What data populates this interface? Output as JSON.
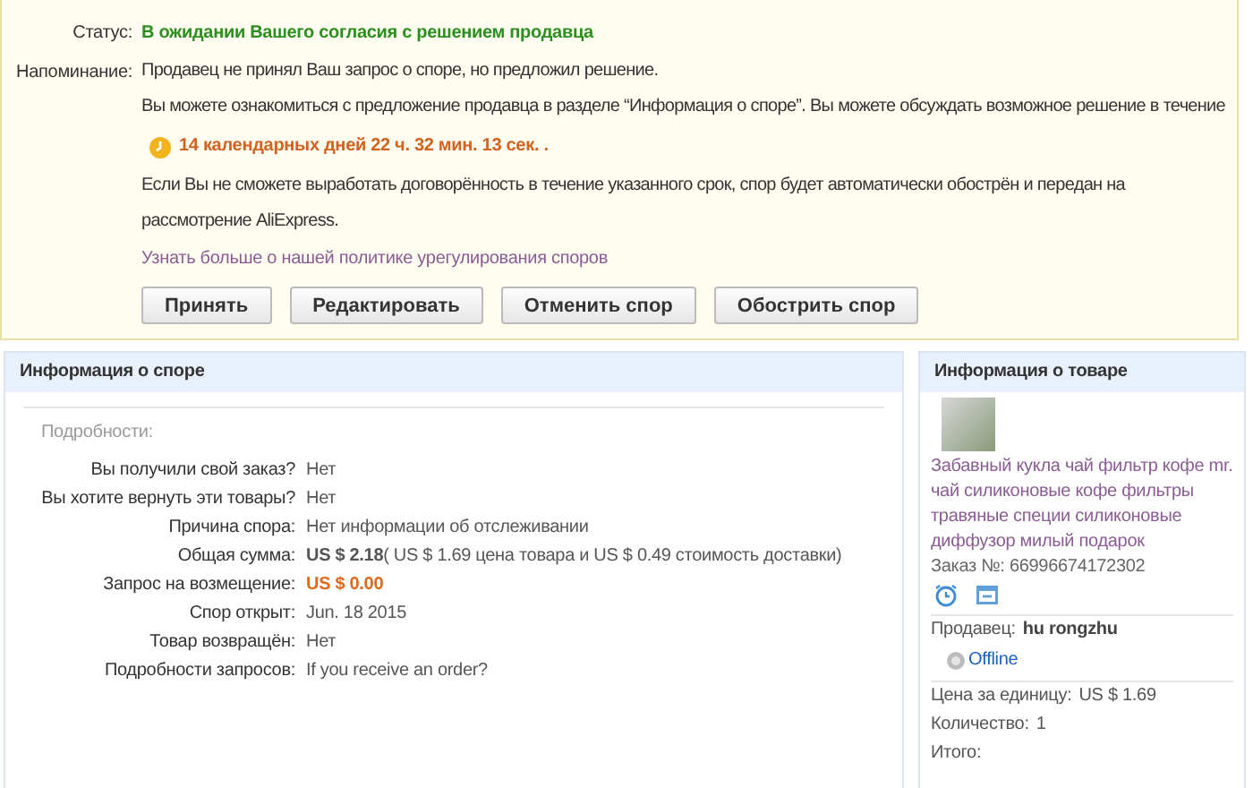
{
  "status": {
    "label": "Статус:",
    "value": "В ожидании Вашего согласия с решением продавца"
  },
  "reminder": {
    "label": "Напоминание:",
    "line_1": "Продавец не принял Ваш запрос о споре, но предложил решение.",
    "line_2": "Вы можете ознакомиться с предложение продавца в разделе “Информация о споре”. Вы можете обсуждать возможное решение в течение",
    "countdown": "14 календарных дней 22 ч. 32 мин. 13 сек. .",
    "line_3": "Если Вы не сможете выработать договорённость в течение указанного срок, спор будет автоматически обострён и передан на рассмотрение AliExpress.",
    "link": "Узнать больше о нашей политике урегулирования споров"
  },
  "buttons": [
    "Принять",
    "Редактировать",
    "Отменить спор",
    "Обострить спор"
  ],
  "dispute_info": {
    "title": "Информация о споре",
    "subtitle": "Подробности:",
    "rows": [
      {
        "label": "Вы получили свой заказ?",
        "value": "Нет",
        "kind": "plain"
      },
      {
        "label": "Вы хотите вернуть эти товары?",
        "value": "Нет",
        "kind": "plain"
      },
      {
        "label": "Причина спора:",
        "value": "Нет информации об отслеживании",
        "kind": "plain"
      },
      {
        "label": "Общая сумма:",
        "value": "**US $ 2.18**( US $ 1.69 цена товара и US $ 0.49 стоимость доставки)",
        "kind": "plain"
      },
      {
        "label": "Запрос на возмещение:",
        "value": "US $ 0.00",
        "kind": "highlight"
      },
      {
        "label": "Спор открыт:",
        "value": "Jun. 18 2015",
        "kind": "plain"
      },
      {
        "label": "Товар возвращён:",
        "value": "Нет",
        "kind": "plain"
      },
      {
        "label": "Подробности запросов:",
        "value": "If you receive an order?",
        "kind": "plain"
      }
    ]
  },
  "product_info": {
    "title": "Информация о товаре",
    "product_name": "Забавный кукла чай фильтр кофе mr. чай силиконовые кофе фильтры травяные специи силиконовые диффузор милый подарок",
    "order_number": "Заказ №: 66996674172302",
    "seller_label": "Продавец:",
    "seller": "hu rongzhu",
    "online": false,
    "online_label": "Offline",
    "fields": [
      {
        "label": "Цена за единицу:",
        "value": "US $ 1.69"
      },
      {
        "label": "Количество:",
        "value": "1"
      },
      {
        "label": "Итого:"
      }
    ]
  }
}
